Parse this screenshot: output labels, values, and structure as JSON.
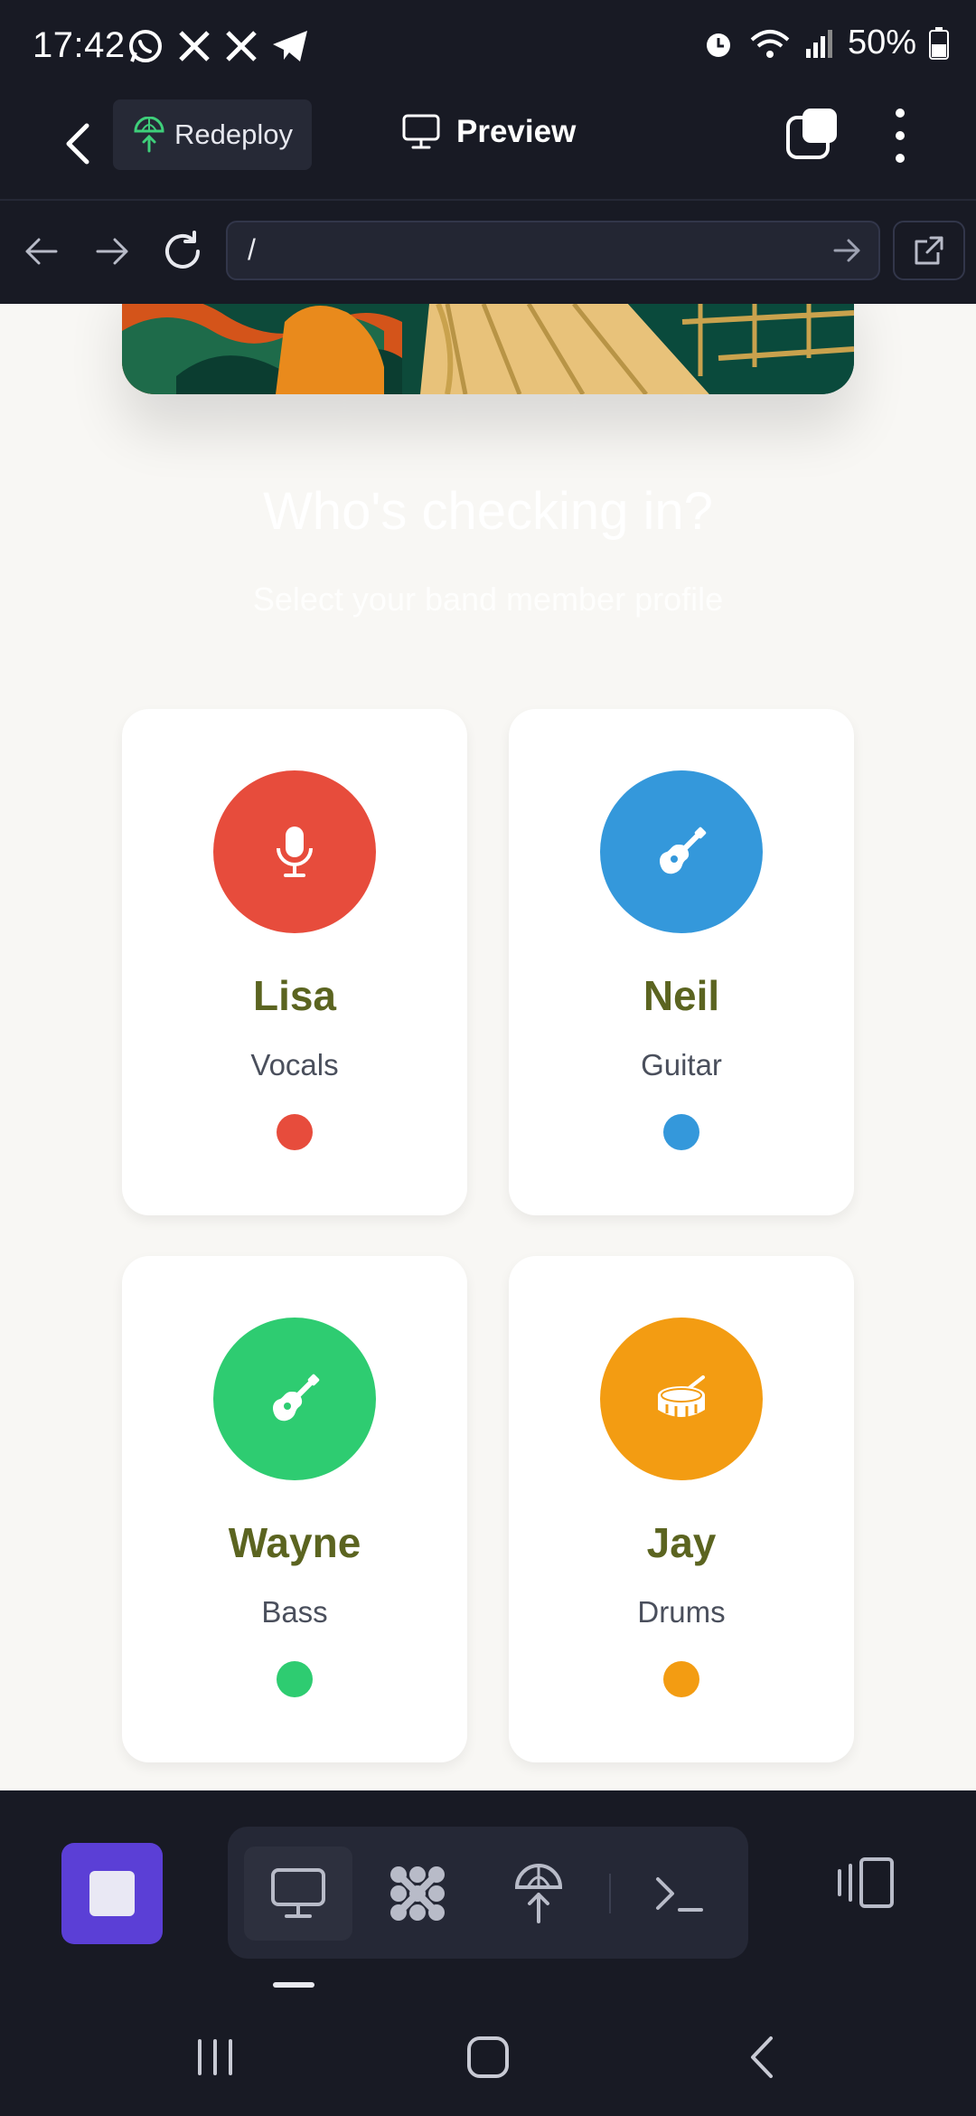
{
  "status_bar": {
    "time": "17:42",
    "notification_icons": [
      "whatsapp-icon",
      "x-icon",
      "x-icon",
      "telegram-icon"
    ],
    "battery": "50%"
  },
  "app_header": {
    "redeploy_label": "Redeploy",
    "title": "Preview"
  },
  "browser": {
    "url": "/"
  },
  "page": {
    "heading": "Who's checking in?",
    "subheading": "Select your band member profile",
    "members": [
      {
        "name": "Lisa",
        "role": "Vocals",
        "color": "#e74c3c",
        "icon": "microphone-icon"
      },
      {
        "name": "Neil",
        "role": "Guitar",
        "color": "#3498db",
        "icon": "guitar-icon"
      },
      {
        "name": "Wayne",
        "role": "Bass",
        "color": "#2ecc71",
        "icon": "guitar-icon"
      },
      {
        "name": "Jay",
        "role": "Drums",
        "color": "#f39c12",
        "icon": "drum-icon"
      }
    ]
  },
  "toolbar": {
    "tools": [
      "preview-icon",
      "packages-icon",
      "deploy-icon",
      "terminal-icon"
    ],
    "accent": "#5b3fd6"
  }
}
